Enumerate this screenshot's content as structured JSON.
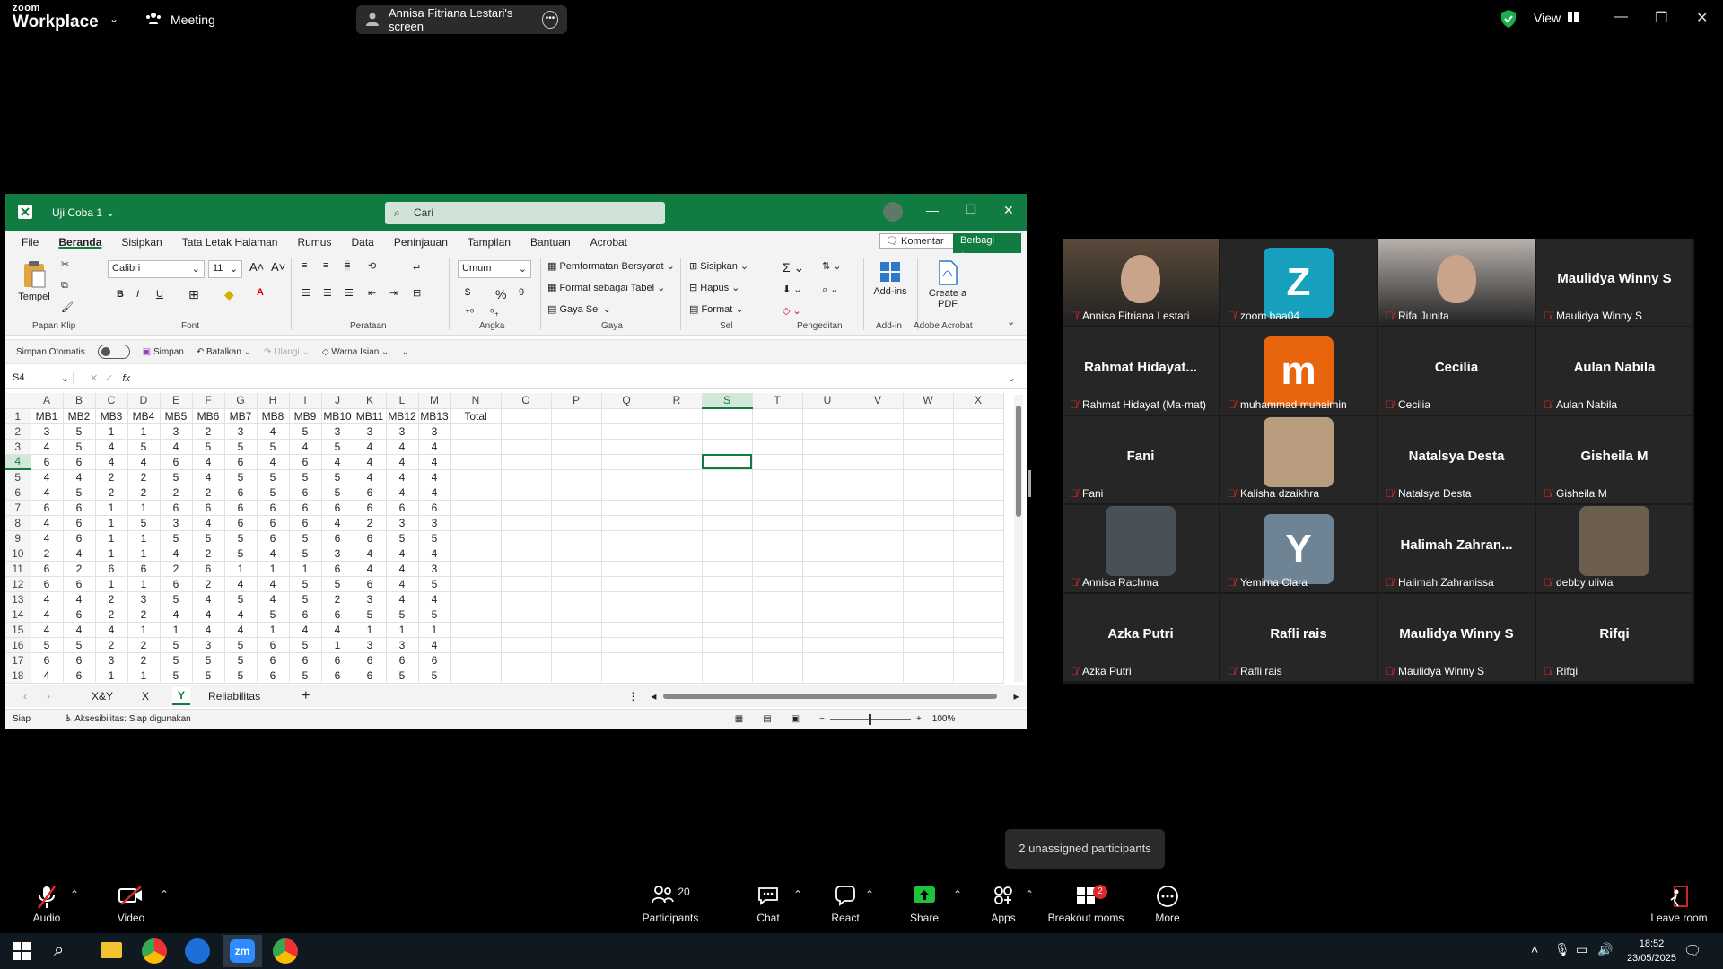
{
  "zoom": {
    "logo_top": "zoom",
    "logo_bottom": "Workplace",
    "meeting_label": "Meeting",
    "share_title": "Annisa Fitriana Lestari's screen",
    "view_label": "View"
  },
  "excel": {
    "doc_title": "Uji Coba 1",
    "search_placeholder": "Cari",
    "menu": [
      "File",
      "Beranda",
      "Sisipkan",
      "Tata Letak Halaman",
      "Rumus",
      "Data",
      "Peninjauan",
      "Tampilan",
      "Bantuan",
      "Acrobat"
    ],
    "comment_btn": "Komentar",
    "share_btn": "Berbagi",
    "ribbon": {
      "paste": "Tempel",
      "font_name": "Calibri",
      "font_size": "11",
      "number_format": "Umum",
      "cond_format": "Pemformatan Bersyarat",
      "format_table": "Format sebagai Tabel",
      "cell_style": "Gaya Sel",
      "insert": "Sisipkan",
      "delete": "Hapus",
      "format": "Format",
      "addins": "Add-ins",
      "create_pdf": "Create a PDF",
      "groups": [
        "Papan Klip",
        "Font",
        "Perataan",
        "Angka",
        "Gaya",
        "Sel",
        "Pengeditan",
        "Add-in",
        "Adobe Acrobat"
      ]
    },
    "qat": {
      "autosave": "Simpan Otomatis",
      "save": "Simpan",
      "undo": "Batalkan",
      "redo": "Ulangi",
      "fill": "Warna Isian"
    },
    "name_box": "S4",
    "col_headers": [
      "A",
      "B",
      "C",
      "D",
      "E",
      "F",
      "G",
      "H",
      "I",
      "J",
      "K",
      "L",
      "M",
      "N",
      "O",
      "P",
      "Q",
      "R",
      "S",
      "T",
      "U",
      "V",
      "W",
      "X"
    ],
    "header_row": [
      "MB1",
      "MB2",
      "MB3",
      "MB4",
      "MB5",
      "MB6",
      "MB7",
      "MB8",
      "MB9",
      "MB10",
      "MB11",
      "MB12",
      "MB13",
      "Total"
    ],
    "rows": [
      [
        3,
        5,
        1,
        1,
        3,
        2,
        3,
        4,
        5,
        3,
        3,
        3,
        3
      ],
      [
        4,
        5,
        4,
        5,
        4,
        5,
        5,
        5,
        4,
        5,
        4,
        4,
        4
      ],
      [
        6,
        6,
        4,
        4,
        6,
        4,
        6,
        4,
        6,
        4,
        4,
        4,
        4
      ],
      [
        4,
        4,
        2,
        2,
        5,
        4,
        5,
        5,
        5,
        5,
        4,
        4,
        4
      ],
      [
        4,
        5,
        2,
        2,
        2,
        2,
        6,
        5,
        6,
        5,
        6,
        4,
        4
      ],
      [
        6,
        6,
        1,
        1,
        6,
        6,
        6,
        6,
        6,
        6,
        6,
        6,
        6
      ],
      [
        4,
        6,
        1,
        5,
        3,
        4,
        6,
        6,
        6,
        4,
        2,
        3,
        3
      ],
      [
        4,
        6,
        1,
        1,
        5,
        5,
        5,
        6,
        5,
        6,
        6,
        5,
        5
      ],
      [
        2,
        4,
        1,
        1,
        4,
        2,
        5,
        4,
        5,
        3,
        4,
        4,
        4
      ],
      [
        6,
        2,
        6,
        6,
        2,
        6,
        1,
        1,
        1,
        6,
        4,
        4,
        3
      ],
      [
        6,
        6,
        1,
        1,
        6,
        2,
        4,
        4,
        5,
        5,
        6,
        4,
        5
      ],
      [
        4,
        4,
        2,
        3,
        5,
        4,
        5,
        4,
        5,
        2,
        3,
        4,
        4
      ],
      [
        4,
        6,
        2,
        2,
        4,
        4,
        4,
        5,
        6,
        6,
        5,
        5,
        5
      ],
      [
        4,
        4,
        4,
        1,
        1,
        4,
        4,
        1,
        4,
        4,
        1,
        1,
        1
      ],
      [
        5,
        5,
        2,
        2,
        5,
        3,
        5,
        6,
        5,
        1,
        3,
        3,
        4
      ],
      [
        6,
        6,
        3,
        2,
        5,
        5,
        5,
        6,
        6,
        6,
        6,
        6,
        6
      ],
      [
        4,
        6,
        1,
        1,
        5,
        5,
        5,
        6,
        5,
        6,
        6,
        5,
        5
      ]
    ],
    "sheets": [
      "X&Y",
      "X",
      "Y",
      "Reliabilitas"
    ],
    "active_sheet": "Y",
    "status_ready": "Siap",
    "status_access": "Aksesibilitas: Siap digunakan",
    "zoom_level": "100%"
  },
  "participants": [
    {
      "name": "Annisa Fitriana Lestari",
      "display": "",
      "kind": "video",
      "color": "#5a4a3a"
    },
    {
      "name": "zoom baa04",
      "display": "Z",
      "kind": "avatar",
      "color": "#16a0bd"
    },
    {
      "name": "Rifa Junita",
      "display": "",
      "kind": "video",
      "color": "#b9b2ad"
    },
    {
      "name": "Maulidya Winny S",
      "display": "Maulidya Winny S",
      "kind": "name"
    },
    {
      "name": "Rahmat Hidayat (Ma-mat)",
      "display": "Rahmat  Hidayat...",
      "kind": "name"
    },
    {
      "name": "muhammad muhaimin",
      "display": "m",
      "kind": "avatar",
      "color": "#e8650e"
    },
    {
      "name": "Cecilia",
      "display": "Cecilia",
      "kind": "name"
    },
    {
      "name": "Aulan Nabila",
      "display": "Aulan Nabila",
      "kind": "name"
    },
    {
      "name": "Fani",
      "display": "Fani",
      "kind": "name"
    },
    {
      "name": "Kalisha dzaikhra",
      "display": "",
      "kind": "photo",
      "color": "#b89c7e"
    },
    {
      "name": "Natalsya Desta",
      "display": "Natalsya Desta",
      "kind": "name"
    },
    {
      "name": "Gisheila M",
      "display": "Gisheila M",
      "kind": "name"
    },
    {
      "name": "Annisa Rachma",
      "display": "",
      "kind": "photo",
      "color": "#4a5058"
    },
    {
      "name": "Yemima Clara",
      "display": "Y",
      "kind": "avatar",
      "color": "#6e8494"
    },
    {
      "name": "Halimah Zahranissa",
      "display": "Halimah  Zahran...",
      "kind": "name"
    },
    {
      "name": "debby ulivia",
      "display": "",
      "kind": "photo",
      "color": "#6b5e4f"
    },
    {
      "name": "Azka Putri",
      "display": "Azka Putri",
      "kind": "name"
    },
    {
      "name": "Rafli rais",
      "display": "Rafli rais",
      "kind": "name"
    },
    {
      "name": "Maulidya Winny S",
      "display": "Maulidya Winny S",
      "kind": "name"
    },
    {
      "name": "Rifqi",
      "display": "Rifqi",
      "kind": "name"
    }
  ],
  "unassigned": "2 unassigned participants",
  "toolbar": {
    "audio": "Audio",
    "video": "Video",
    "participants_count": "20",
    "participants": "Participants",
    "chat": "Chat",
    "react": "React",
    "share": "Share",
    "apps": "Apps",
    "breakout": "Breakout rooms",
    "breakout_badge": "2",
    "more": "More",
    "leave": "Leave room"
  },
  "taskbar": {
    "time": "18:52",
    "date": "23/05/2025"
  }
}
